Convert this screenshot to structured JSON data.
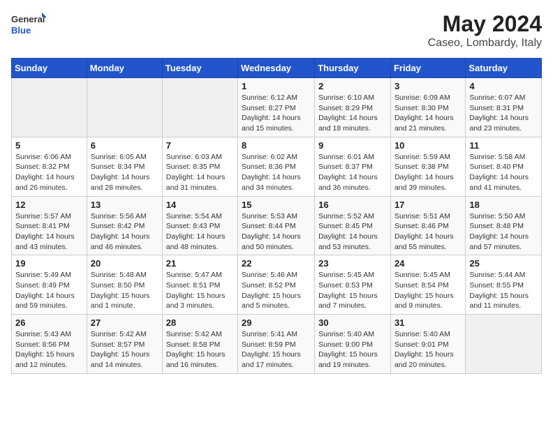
{
  "header": {
    "logo_general": "General",
    "logo_blue": "Blue",
    "month": "May 2024",
    "location": "Caseo, Lombardy, Italy"
  },
  "days_of_week": [
    "Sunday",
    "Monday",
    "Tuesday",
    "Wednesday",
    "Thursday",
    "Friday",
    "Saturday"
  ],
  "weeks": [
    [
      {
        "day": "",
        "info": ""
      },
      {
        "day": "",
        "info": ""
      },
      {
        "day": "",
        "info": ""
      },
      {
        "day": "1",
        "info": "Sunrise: 6:12 AM\nSunset: 8:27 PM\nDaylight: 14 hours and 15 minutes."
      },
      {
        "day": "2",
        "info": "Sunrise: 6:10 AM\nSunset: 8:29 PM\nDaylight: 14 hours and 18 minutes."
      },
      {
        "day": "3",
        "info": "Sunrise: 6:09 AM\nSunset: 8:30 PM\nDaylight: 14 hours and 21 minutes."
      },
      {
        "day": "4",
        "info": "Sunrise: 6:07 AM\nSunset: 8:31 PM\nDaylight: 14 hours and 23 minutes."
      }
    ],
    [
      {
        "day": "5",
        "info": "Sunrise: 6:06 AM\nSunset: 8:32 PM\nDaylight: 14 hours and 26 minutes."
      },
      {
        "day": "6",
        "info": "Sunrise: 6:05 AM\nSunset: 8:34 PM\nDaylight: 14 hours and 28 minutes."
      },
      {
        "day": "7",
        "info": "Sunrise: 6:03 AM\nSunset: 8:35 PM\nDaylight: 14 hours and 31 minutes."
      },
      {
        "day": "8",
        "info": "Sunrise: 6:02 AM\nSunset: 8:36 PM\nDaylight: 14 hours and 34 minutes."
      },
      {
        "day": "9",
        "info": "Sunrise: 6:01 AM\nSunset: 8:37 PM\nDaylight: 14 hours and 36 minutes."
      },
      {
        "day": "10",
        "info": "Sunrise: 5:59 AM\nSunset: 8:38 PM\nDaylight: 14 hours and 39 minutes."
      },
      {
        "day": "11",
        "info": "Sunrise: 5:58 AM\nSunset: 8:40 PM\nDaylight: 14 hours and 41 minutes."
      }
    ],
    [
      {
        "day": "12",
        "info": "Sunrise: 5:57 AM\nSunset: 8:41 PM\nDaylight: 14 hours and 43 minutes."
      },
      {
        "day": "13",
        "info": "Sunrise: 5:56 AM\nSunset: 8:42 PM\nDaylight: 14 hours and 46 minutes."
      },
      {
        "day": "14",
        "info": "Sunrise: 5:54 AM\nSunset: 8:43 PM\nDaylight: 14 hours and 48 minutes."
      },
      {
        "day": "15",
        "info": "Sunrise: 5:53 AM\nSunset: 8:44 PM\nDaylight: 14 hours and 50 minutes."
      },
      {
        "day": "16",
        "info": "Sunrise: 5:52 AM\nSunset: 8:45 PM\nDaylight: 14 hours and 53 minutes."
      },
      {
        "day": "17",
        "info": "Sunrise: 5:51 AM\nSunset: 8:46 PM\nDaylight: 14 hours and 55 minutes."
      },
      {
        "day": "18",
        "info": "Sunrise: 5:50 AM\nSunset: 8:48 PM\nDaylight: 14 hours and 57 minutes."
      }
    ],
    [
      {
        "day": "19",
        "info": "Sunrise: 5:49 AM\nSunset: 8:49 PM\nDaylight: 14 hours and 59 minutes."
      },
      {
        "day": "20",
        "info": "Sunrise: 5:48 AM\nSunset: 8:50 PM\nDaylight: 15 hours and 1 minute."
      },
      {
        "day": "21",
        "info": "Sunrise: 5:47 AM\nSunset: 8:51 PM\nDaylight: 15 hours and 3 minutes."
      },
      {
        "day": "22",
        "info": "Sunrise: 5:46 AM\nSunset: 8:52 PM\nDaylight: 15 hours and 5 minutes."
      },
      {
        "day": "23",
        "info": "Sunrise: 5:45 AM\nSunset: 8:53 PM\nDaylight: 15 hours and 7 minutes."
      },
      {
        "day": "24",
        "info": "Sunrise: 5:45 AM\nSunset: 8:54 PM\nDaylight: 15 hours and 9 minutes."
      },
      {
        "day": "25",
        "info": "Sunrise: 5:44 AM\nSunset: 8:55 PM\nDaylight: 15 hours and 11 minutes."
      }
    ],
    [
      {
        "day": "26",
        "info": "Sunrise: 5:43 AM\nSunset: 8:56 PM\nDaylight: 15 hours and 12 minutes."
      },
      {
        "day": "27",
        "info": "Sunrise: 5:42 AM\nSunset: 8:57 PM\nDaylight: 15 hours and 14 minutes."
      },
      {
        "day": "28",
        "info": "Sunrise: 5:42 AM\nSunset: 8:58 PM\nDaylight: 15 hours and 16 minutes."
      },
      {
        "day": "29",
        "info": "Sunrise: 5:41 AM\nSunset: 8:59 PM\nDaylight: 15 hours and 17 minutes."
      },
      {
        "day": "30",
        "info": "Sunrise: 5:40 AM\nSunset: 9:00 PM\nDaylight: 15 hours and 19 minutes."
      },
      {
        "day": "31",
        "info": "Sunrise: 5:40 AM\nSunset: 9:01 PM\nDaylight: 15 hours and 20 minutes."
      },
      {
        "day": "",
        "info": ""
      }
    ]
  ]
}
